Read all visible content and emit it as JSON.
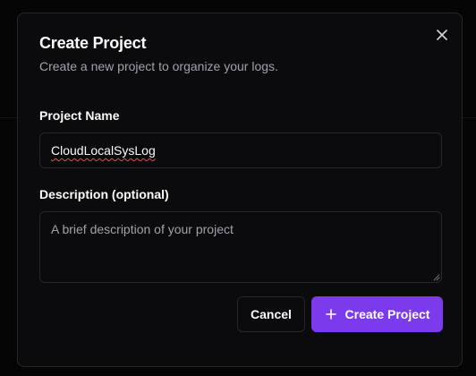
{
  "dialog": {
    "title": "Create Project",
    "subtitle": "Create a new project to organize your logs.",
    "close_icon": "close-icon"
  },
  "form": {
    "name_label": "Project Name",
    "name_value": "CloudLocalSysLog",
    "description_label": "Description (optional)",
    "description_placeholder": "A brief description of your project",
    "description_value": ""
  },
  "actions": {
    "cancel_label": "Cancel",
    "create_label": "Create Project",
    "create_icon": "plus-icon"
  },
  "colors": {
    "background": "#050506",
    "dialog_background": "#0b0b0d",
    "border": "#27272a",
    "text_primary": "#fafafa",
    "text_muted": "#a1a1aa",
    "accent": "#7c3aed",
    "spellcheck": "#e5484d"
  }
}
